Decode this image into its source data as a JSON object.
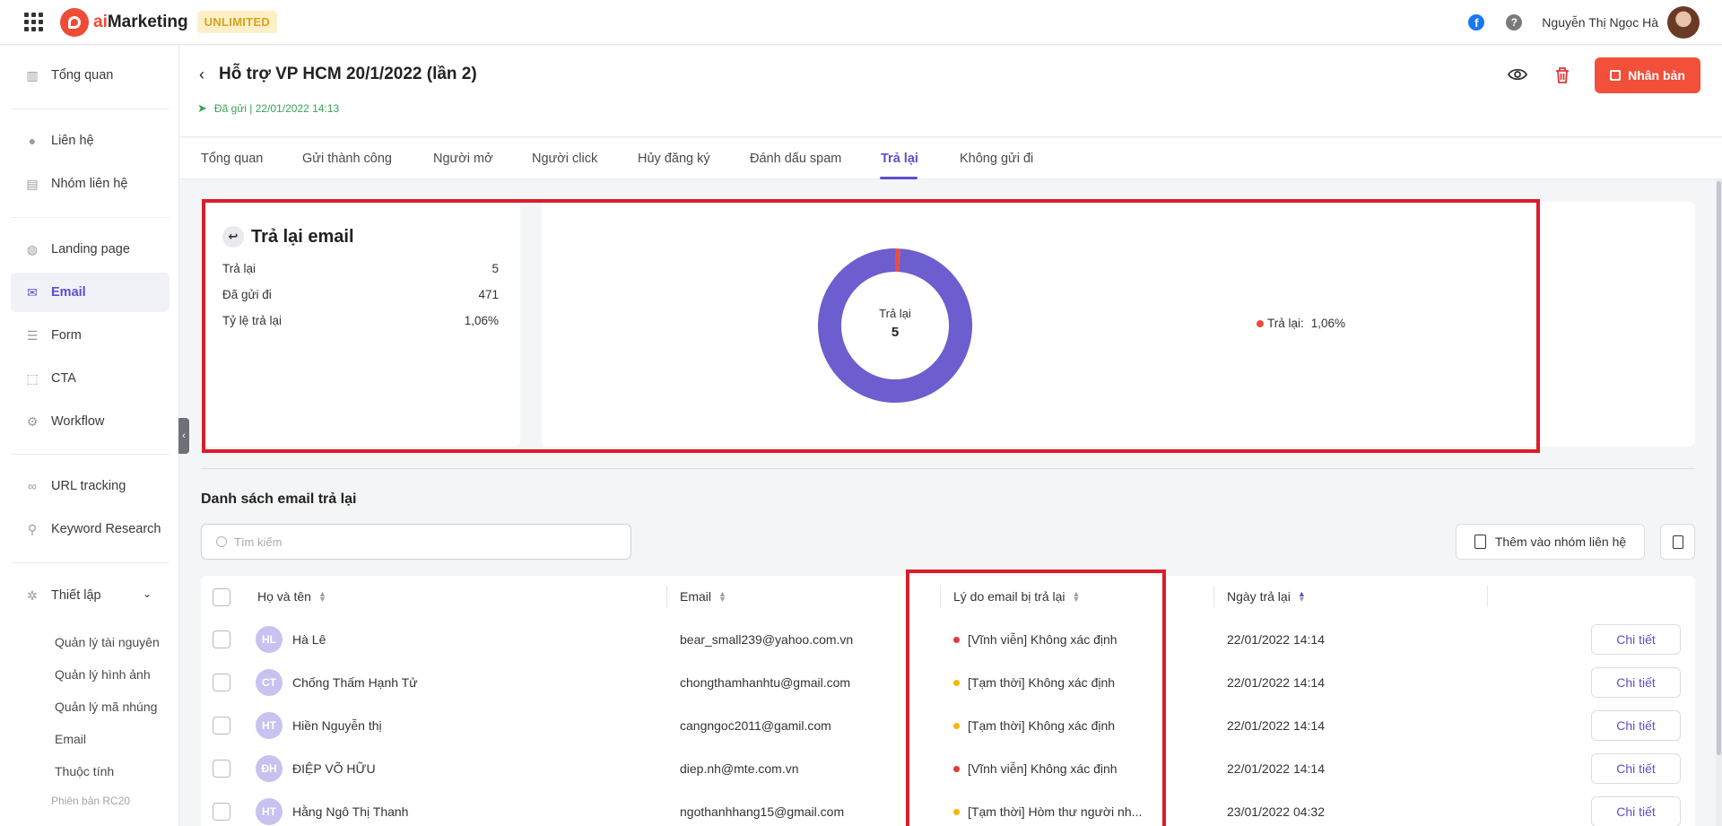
{
  "app": {
    "logo_text_ai": "ai",
    "logo_text_rest": "Marketing",
    "plan_badge": "UNLIMITED",
    "user_name": "Nguyễn Thị Ngọc Hà",
    "facebook_glyph": "f",
    "help_glyph": "?"
  },
  "sidebar": {
    "items": [
      {
        "label": "Tổng quan",
        "icon": "chart-icon"
      },
      {
        "label": "Liên hệ",
        "icon": "user-icon"
      },
      {
        "label": "Nhóm liên hệ",
        "icon": "contact-book-icon"
      },
      {
        "label": "Landing page",
        "icon": "globe-icon"
      },
      {
        "label": "Email",
        "icon": "mail-icon",
        "active": true
      },
      {
        "label": "Form",
        "icon": "form-icon"
      },
      {
        "label": "CTA",
        "icon": "cta-icon"
      },
      {
        "label": "Workflow",
        "icon": "workflow-icon"
      },
      {
        "label": "URL tracking",
        "icon": "link-icon"
      },
      {
        "label": "Keyword Research",
        "icon": "keyword-icon"
      },
      {
        "label": "Thiết lập",
        "icon": "gear-icon"
      }
    ],
    "sub_items": [
      "Quản lý tài nguyên",
      "Quản lý hình ảnh",
      "Quản lý mã nhúng",
      "Email",
      "Thuộc tính"
    ],
    "version": "Phiên bản RC20"
  },
  "header": {
    "title": "Hỗ trợ VP HCM 20/1/2022 (lần 2)",
    "status": "Đã gửi | 22/01/2022 14:13",
    "clone_button": "Nhân bản"
  },
  "tabs": [
    "Tổng quan",
    "Gửi thành công",
    "Người mở",
    "Người click",
    "Hủy đăng ký",
    "Đánh dấu spam",
    "Trả lại",
    "Không gửi đi"
  ],
  "active_tab": 6,
  "summary": {
    "title": "Trả lại email",
    "rows": [
      {
        "label": "Trả lại",
        "value": "5"
      },
      {
        "label": "Đã gửi đi",
        "value": "471"
      },
      {
        "label": "Tỷ lệ trả lại",
        "value": "1,06%"
      }
    ]
  },
  "chart_data": {
    "type": "pie",
    "variant": "donut",
    "slices": [
      {
        "name": "Trả lại",
        "value": 5,
        "color": "#ea4d3b"
      },
      {
        "value": 466,
        "color": "#6c5ecf"
      }
    ],
    "center_label": "Trả lại",
    "center_value": "5",
    "legend": [
      {
        "name": "Trả lại:",
        "value": "1,06%",
        "color": "#ea4d3b"
      }
    ],
    "legend_position": "right"
  },
  "list": {
    "title": "Danh sách email trả lại",
    "search_placeholder": "Tìm kiếm",
    "add_group_button": "Thêm vào nhóm liên hệ",
    "columns": [
      "Họ và tên",
      "Email",
      "Lý do email bị trả lại",
      "Ngày trả lại"
    ],
    "detail_label": "Chi tiết",
    "rows": [
      {
        "initials": "HL",
        "name": "Hà Lê",
        "email": "bear_small239@yahoo.com.vn",
        "reason": "[Vĩnh viễn] Không xác định",
        "reason_color": "#e03a3a",
        "date": "22/01/2022 14:14"
      },
      {
        "initials": "CT",
        "name": "Chống Thấm Hạnh Tử",
        "email": "chongthamhanhtu@gmail.com",
        "reason": "[Tạm thời] Không xác định",
        "reason_color": "#f5b800",
        "date": "22/01/2022 14:14"
      },
      {
        "initials": "HT",
        "name": "Hiền Nguyễn thị",
        "email": "cangngoc2011@gamil.com",
        "reason": "[Tạm thời] Không xác định",
        "reason_color": "#f5b800",
        "date": "22/01/2022 14:14"
      },
      {
        "initials": "ĐH",
        "name": "ĐIỆP VÕ HỮU",
        "email": "diep.nh@mte.com.vn",
        "reason": "[Vĩnh viễn] Không xác định",
        "reason_color": "#e03a3a",
        "date": "22/01/2022 14:14"
      },
      {
        "initials": "HT",
        "name": "Hằng Ngô Thị Thanh",
        "email": "ngothanhhang15@gmail.com",
        "reason": "[Tạm thời] Hòm thư người nh...",
        "reason_color": "#f5b800",
        "date": "23/01/2022 04:32"
      }
    ]
  }
}
